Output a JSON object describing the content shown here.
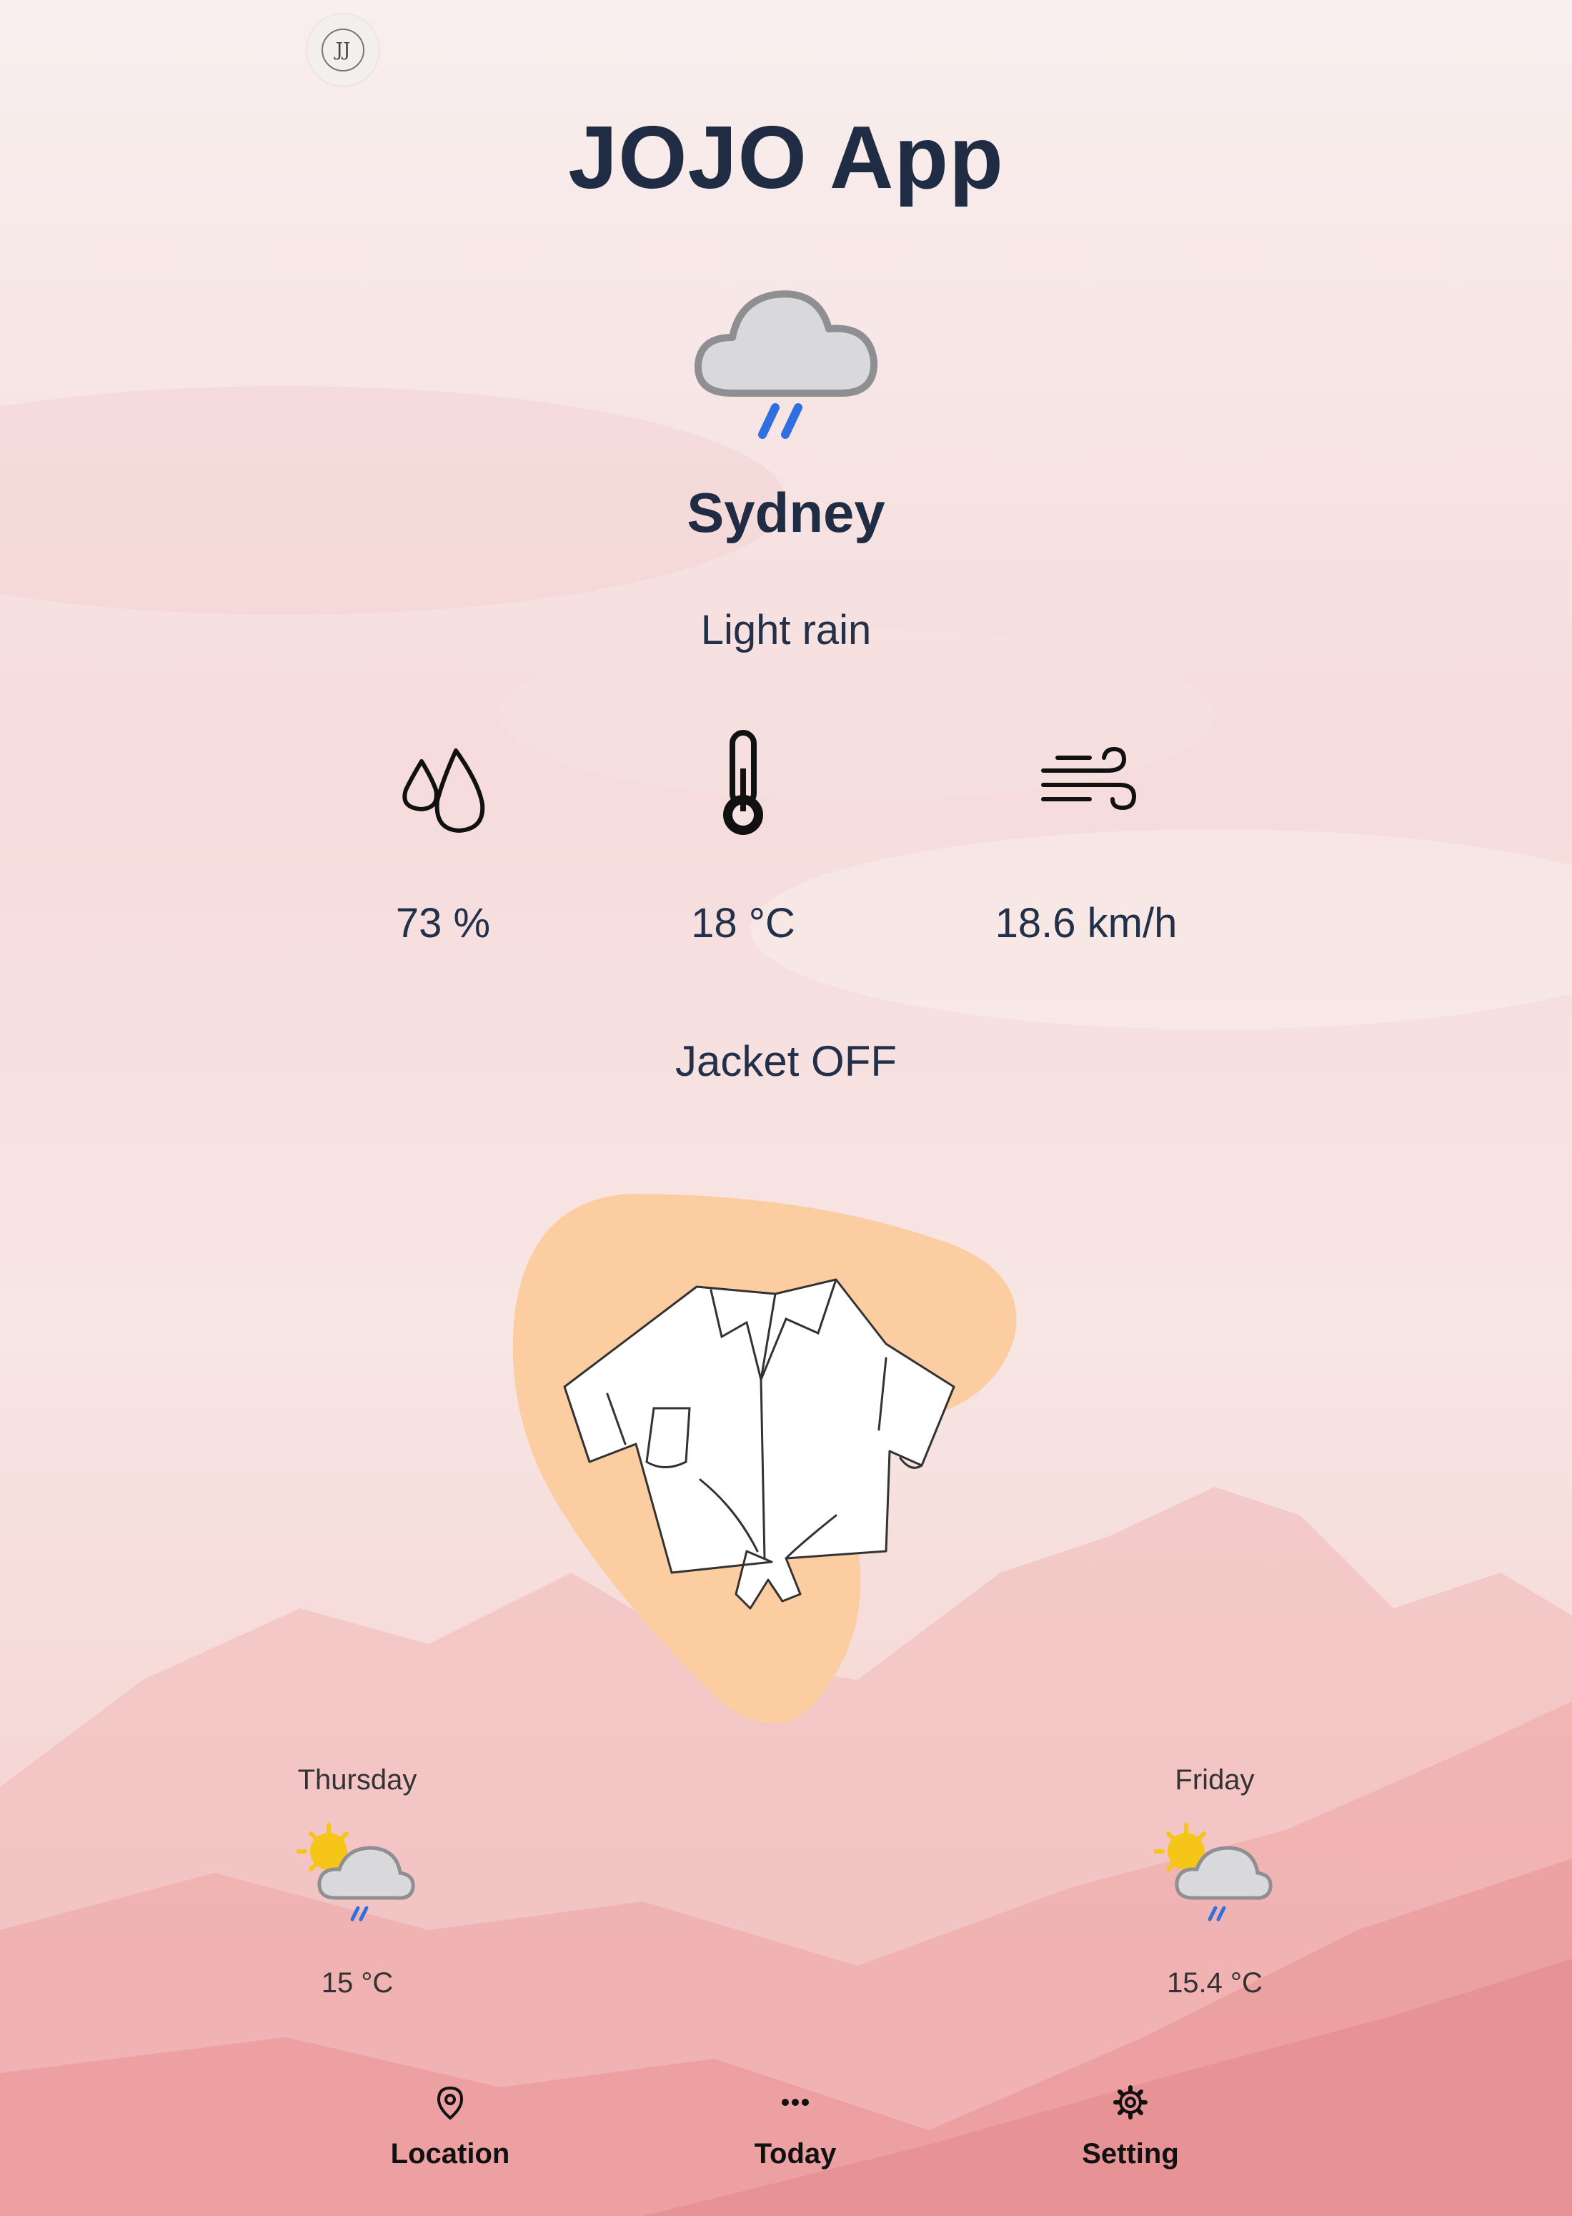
{
  "app": {
    "title": "JOJO App",
    "logo_text": "JJ"
  },
  "current": {
    "city": "Sydney",
    "condition": "Light rain",
    "icon": "cloud-rain-icon"
  },
  "stats": [
    {
      "name": "humidity",
      "icon": "humidity-drops-icon",
      "value": "73 %"
    },
    {
      "name": "temperature",
      "icon": "thermometer-icon",
      "value": "18 °C"
    },
    {
      "name": "wind",
      "icon": "wind-icon",
      "value": "18.6 km/h"
    }
  ],
  "jacket_status": "Jacket OFF",
  "outfit": {
    "icon": "shirt-icon",
    "blob_color": "#fbcda0"
  },
  "forecast": [
    {
      "day": "Thursday",
      "icon": "sun-cloud-rain-icon",
      "temp": "15 °C"
    },
    {
      "day": "Friday",
      "icon": "sun-cloud-rain-icon",
      "temp": "15.4 °C"
    }
  ],
  "nav": [
    {
      "label": "Location",
      "icon": "map-pin-icon"
    },
    {
      "label": "Today",
      "icon": "more-dots-icon"
    },
    {
      "label": "Setting",
      "icon": "gear-icon"
    }
  ],
  "colors": {
    "title": "#1f2c44",
    "rain": "#2f6fe0",
    "sun": "#f5c518"
  }
}
